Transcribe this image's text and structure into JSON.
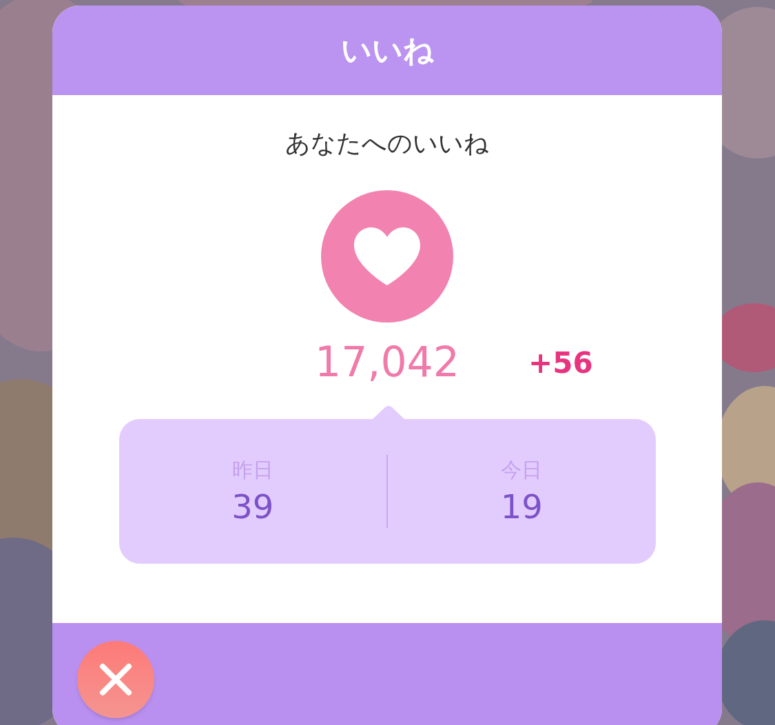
{
  "dialog": {
    "title": "いいね",
    "heading": "あなたへのいいね",
    "total": "17,042",
    "increase": "+56",
    "breakdown": [
      {
        "label": "昨日",
        "value": "39"
      },
      {
        "label": "今日",
        "value": "19"
      }
    ]
  }
}
